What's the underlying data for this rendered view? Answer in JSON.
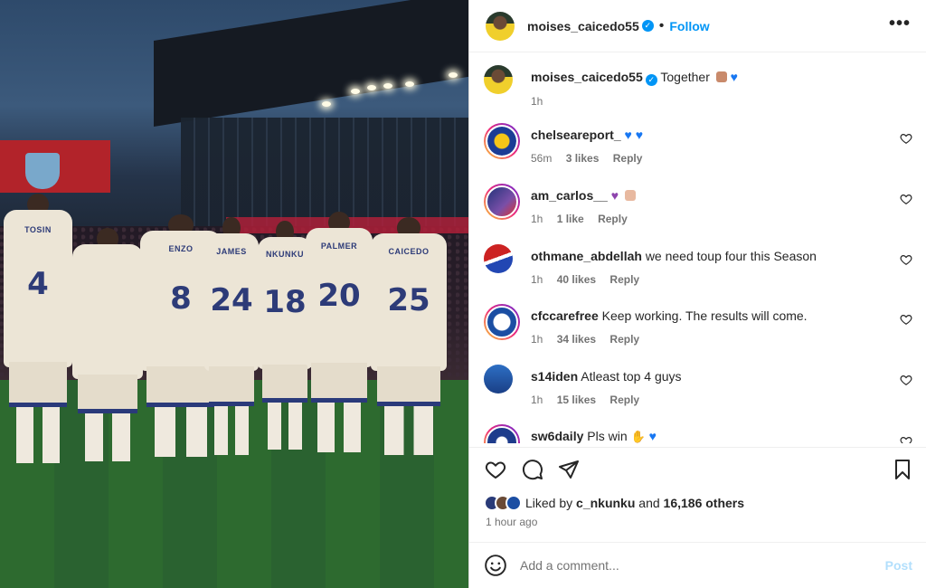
{
  "media": {
    "alt_players": [
      {
        "name": "TOSIN",
        "number": "4"
      },
      {
        "name": "ENZO",
        "number": "8"
      },
      {
        "name": "JAMES",
        "number": "24"
      },
      {
        "name": "NKUNKU",
        "number": "18"
      },
      {
        "name": "PALMER",
        "number": "20"
      },
      {
        "name": "CAICEDO",
        "number": "25"
      }
    ]
  },
  "header": {
    "username": "moises_caicedo55",
    "separator": "•",
    "follow_label": "Follow",
    "more_label": "•••"
  },
  "caption": {
    "username": "moises_caicedo55",
    "text": "Together",
    "time": "1h"
  },
  "comments": [
    {
      "username": "chelseareport_",
      "text": "",
      "time": "56m",
      "likes": "3 likes",
      "reply": "Reply"
    },
    {
      "username": "am_carlos__",
      "text": "",
      "time": "1h",
      "likes": "1 like",
      "reply": "Reply"
    },
    {
      "username": "othmane_abdellah",
      "text": "we need toup four this Season",
      "time": "1h",
      "likes": "40 likes",
      "reply": "Reply"
    },
    {
      "username": "cfccarefree",
      "text": "Keep working. The results will come.",
      "time": "1h",
      "likes": "34 likes",
      "reply": "Reply"
    },
    {
      "username": "s14iden",
      "text": "Atleast top 4 guys",
      "time": "1h",
      "likes": "15 likes",
      "reply": "Reply"
    },
    {
      "username": "sw6daily",
      "text": "Pls win",
      "time": "",
      "likes": "",
      "reply": ""
    }
  ],
  "likes": {
    "prefix": "Liked by",
    "user": "c_nkunku",
    "and": "and",
    "others": "16,186 others"
  },
  "posted": "1 hour ago",
  "add_comment": {
    "placeholder": "Add a comment...",
    "post_label": "Post"
  },
  "colors": {
    "accent": "#0095f6",
    "verified": "#0095f6",
    "post_disabled": "#b2dffc"
  }
}
